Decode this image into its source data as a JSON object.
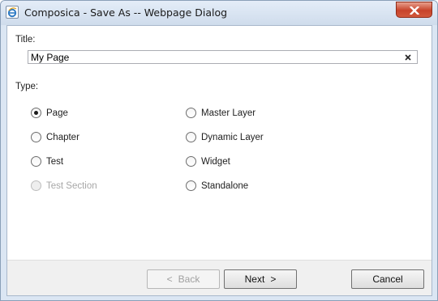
{
  "window": {
    "title": "Composica - Save As -- Webpage Dialog"
  },
  "form": {
    "title_label": "Title:",
    "title_value": "My Page",
    "type_label": "Type:"
  },
  "types": {
    "left": [
      {
        "label": "Page",
        "checked": true,
        "disabled": false
      },
      {
        "label": "Chapter",
        "checked": false,
        "disabled": false
      },
      {
        "label": "Test",
        "checked": false,
        "disabled": false
      },
      {
        "label": "Test Section",
        "checked": false,
        "disabled": true
      }
    ],
    "right": [
      {
        "label": "Master Layer",
        "checked": false,
        "disabled": false
      },
      {
        "label": "Dynamic Layer",
        "checked": false,
        "disabled": false
      },
      {
        "label": "Widget",
        "checked": false,
        "disabled": false
      },
      {
        "label": "Standalone",
        "checked": false,
        "disabled": false
      }
    ]
  },
  "footer": {
    "back_label": "Back",
    "back_arrow": "<",
    "next_label": "Next",
    "next_arrow": ">",
    "cancel_label": "Cancel"
  }
}
